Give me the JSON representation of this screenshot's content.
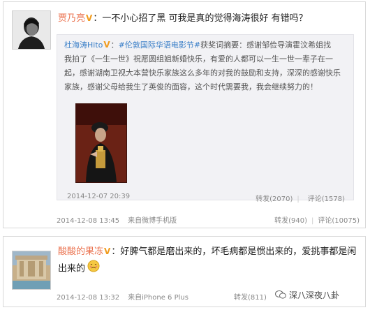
{
  "post1": {
    "username": "贾乃亮",
    "text": "：一不小心招了黑 可我是真的觉得海涛很好 有错吗？",
    "quoted": {
      "username": "杜海涛Hito",
      "colon": "：",
      "hashtag": "#伦敦国际华语电影节#",
      "line1_rest": "获奖词摘要：感谢邹俭导演霍汶希姐找",
      "line2": "我拍了《一生一世》祝愿圆组姐新婚快乐，有爱的人都可以一生一世一辈子在一",
      "line3": "起，感谢湖南卫视大本营快乐家族这么多年的对我的鼓励和支持，深深的感谢快乐",
      "line4": "家族，感谢父母给我生了英俊的面容，这个时代需要我，我会继续努力的！",
      "time": "2014-12-07 20:39",
      "repost": "转发(2070)",
      "comment": "评论(1578)"
    },
    "time": "2014-12-08 13:45",
    "source": "来自微博手机版",
    "repost": "转发(940)",
    "comment": "评论(10075)"
  },
  "post2": {
    "username": "酸酸的果冻",
    "text_line1": "：好脾气都是磨出来的，坏毛病都是惯出来的，爱挑事都是闲",
    "text_line2": "出来的",
    "time": "2014-12-08 13:32",
    "source": "来自iPhone 6 Plus",
    "repost": "转发(811)"
  },
  "vip_mark": "V",
  "separator": "|",
  "watermark": "深八深夜八卦"
}
